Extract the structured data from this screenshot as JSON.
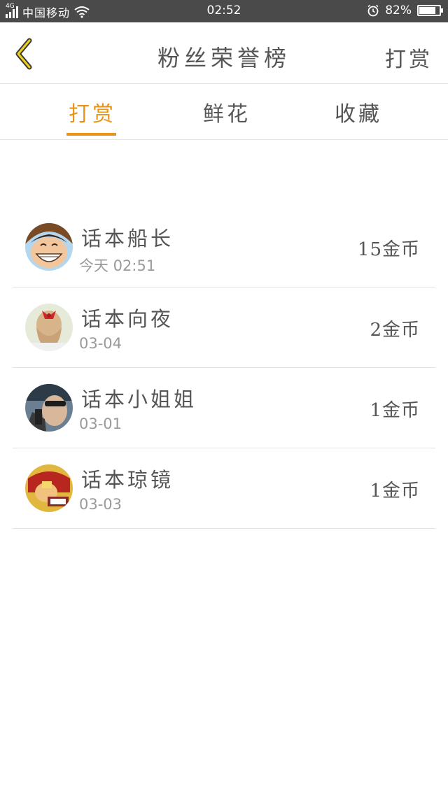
{
  "status_bar": {
    "network": "4G",
    "carrier": "中国移动",
    "time": "02:52",
    "battery": "82%",
    "battery_level": 0.82
  },
  "header": {
    "back_icon": "chevron-left-icon",
    "title": "粉丝荣誉榜",
    "action_label": "打赏"
  },
  "tabs": [
    {
      "label": "打赏",
      "active": true
    },
    {
      "label": "鲜花",
      "active": false
    },
    {
      "label": "收藏",
      "active": false
    }
  ],
  "colors": {
    "accent": "#e8941a",
    "status_bar": "#4a4a4a",
    "text": "#555555",
    "muted": "#9a9a9a"
  },
  "fans": [
    {
      "name": "话本船长",
      "date": "今天 02:51",
      "amount": "15金币"
    },
    {
      "name": "话本向夜",
      "date": "03-04",
      "amount": "2金币"
    },
    {
      "name": "话本小姐姐",
      "date": "03-01",
      "amount": "1金币"
    },
    {
      "name": "话本琼镜",
      "date": "03-03",
      "amount": "1金币"
    }
  ]
}
